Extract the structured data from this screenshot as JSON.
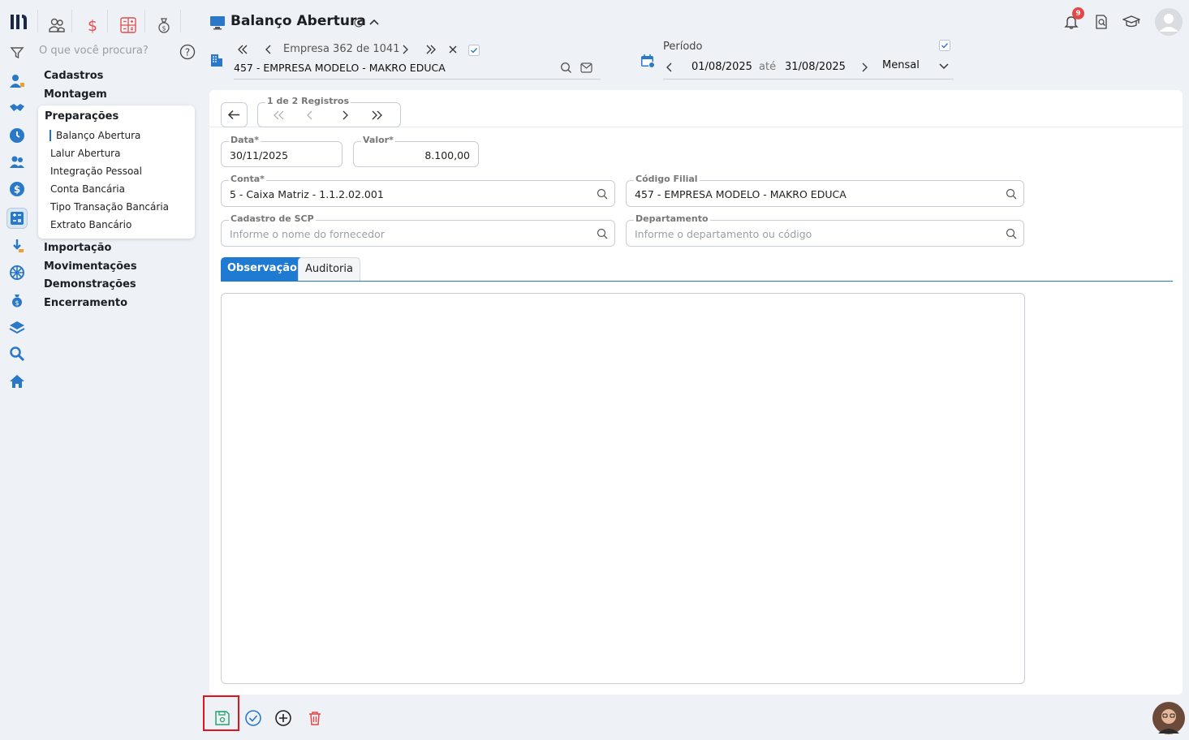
{
  "colors": {
    "brand": "#1f7ad1",
    "icon_blue": "#2a78c8",
    "danger": "#e94545",
    "save_green": "#2ba36b"
  },
  "top_tools": [
    "clients-icon",
    "dollar-icon",
    "calculator-icon",
    "money-bag-icon"
  ],
  "search": {
    "placeholder": "O que você procura?"
  },
  "menu": {
    "cadastros": "Cadastros",
    "montagem": "Montagem",
    "preparacoes": {
      "label": "Preparações",
      "items": [
        "Balanço Abertura",
        "Lalur Abertura",
        "Integração Pessoal",
        "Conta Bancária",
        "Tipo Transação Bancária",
        "Extrato Bancário"
      ]
    },
    "importacao": "Importação",
    "movimentacoes": "Movimentações",
    "demonstracoes": "Demonstrações",
    "encerramento": "Encerramento"
  },
  "header": {
    "title": "Balanço Abertura",
    "empresa_nav": "Empresa 362 de 1041",
    "empresa": "457 - EMPRESA MODELO - MAKRO EDUCA",
    "periodo_label": "Período",
    "periodo_start": "01/08/2025",
    "periodo_sep": "até",
    "periodo_end": "31/08/2025",
    "periodo_type": "Mensal",
    "notifications_count": "9"
  },
  "form": {
    "registros_label": "1 de 2 Registros",
    "data_label": "Data*",
    "data_value": "30/11/2025",
    "valor_label": "Valor*",
    "valor_value": "8.100,00",
    "conta_label": "Conta*",
    "conta_value": "5 - Caixa Matriz  - 1.1.2.02.001",
    "filial_label": "Código Filial",
    "filial_value": "457 - EMPRESA MODELO - MAKRO EDUCA",
    "scp_label": "Cadastro de SCP",
    "scp_placeholder": "Informe o nome do fornecedor",
    "dept_label": "Departamento",
    "dept_placeholder": "Informe o departamento ou código"
  },
  "tabs": [
    "Observação",
    "Auditoria"
  ]
}
